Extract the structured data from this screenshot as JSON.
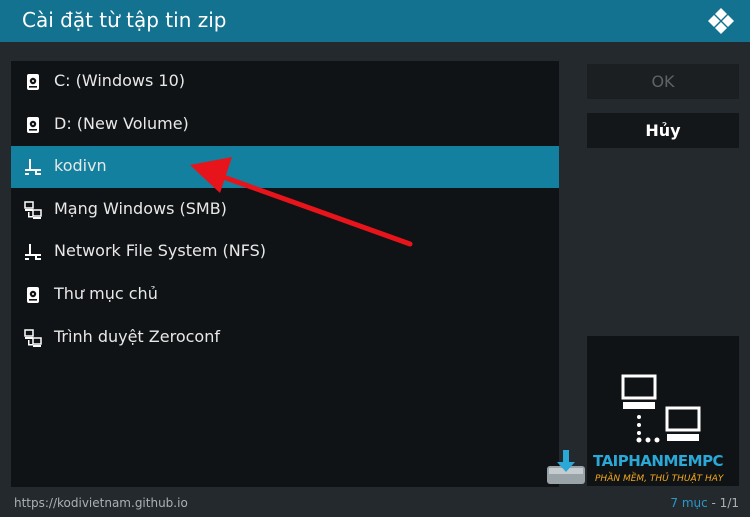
{
  "dialog": {
    "title": "Cài đặt từ tập tin zip"
  },
  "sources": [
    {
      "label": "C: (Windows 10)",
      "icon": "hard-drive-icon",
      "selected": false
    },
    {
      "label": "D: (New Volume)",
      "icon": "hard-drive-icon",
      "selected": false
    },
    {
      "label": "kodivn",
      "icon": "network-share-icon",
      "selected": true
    },
    {
      "label": "Mạng Windows (SMB)",
      "icon": "network-computers-icon",
      "selected": false
    },
    {
      "label": "Network File System (NFS)",
      "icon": "network-share-icon",
      "selected": false
    },
    {
      "label": "Thư mục chủ",
      "icon": "hard-drive-icon",
      "selected": false
    },
    {
      "label": "Trình duyệt Zeroconf",
      "icon": "network-computers-icon",
      "selected": false
    }
  ],
  "buttons": {
    "ok": "OK",
    "cancel": "Hủy"
  },
  "footer": {
    "path": "https://kodivietnam.github.io",
    "count_label": "7 mục",
    "page_label": " - 1/1"
  },
  "watermark": {
    "title": "TAIPHANMEMPC",
    "subtitle": "PHẦN MỀM, THỦ THUẬT HAY"
  },
  "colors": {
    "accent": "#12809e",
    "title_bar": "#13728f",
    "annotation_arrow": "#e8141b",
    "watermark_blue": "#2aa8d8",
    "watermark_orange": "#f2a81d"
  }
}
